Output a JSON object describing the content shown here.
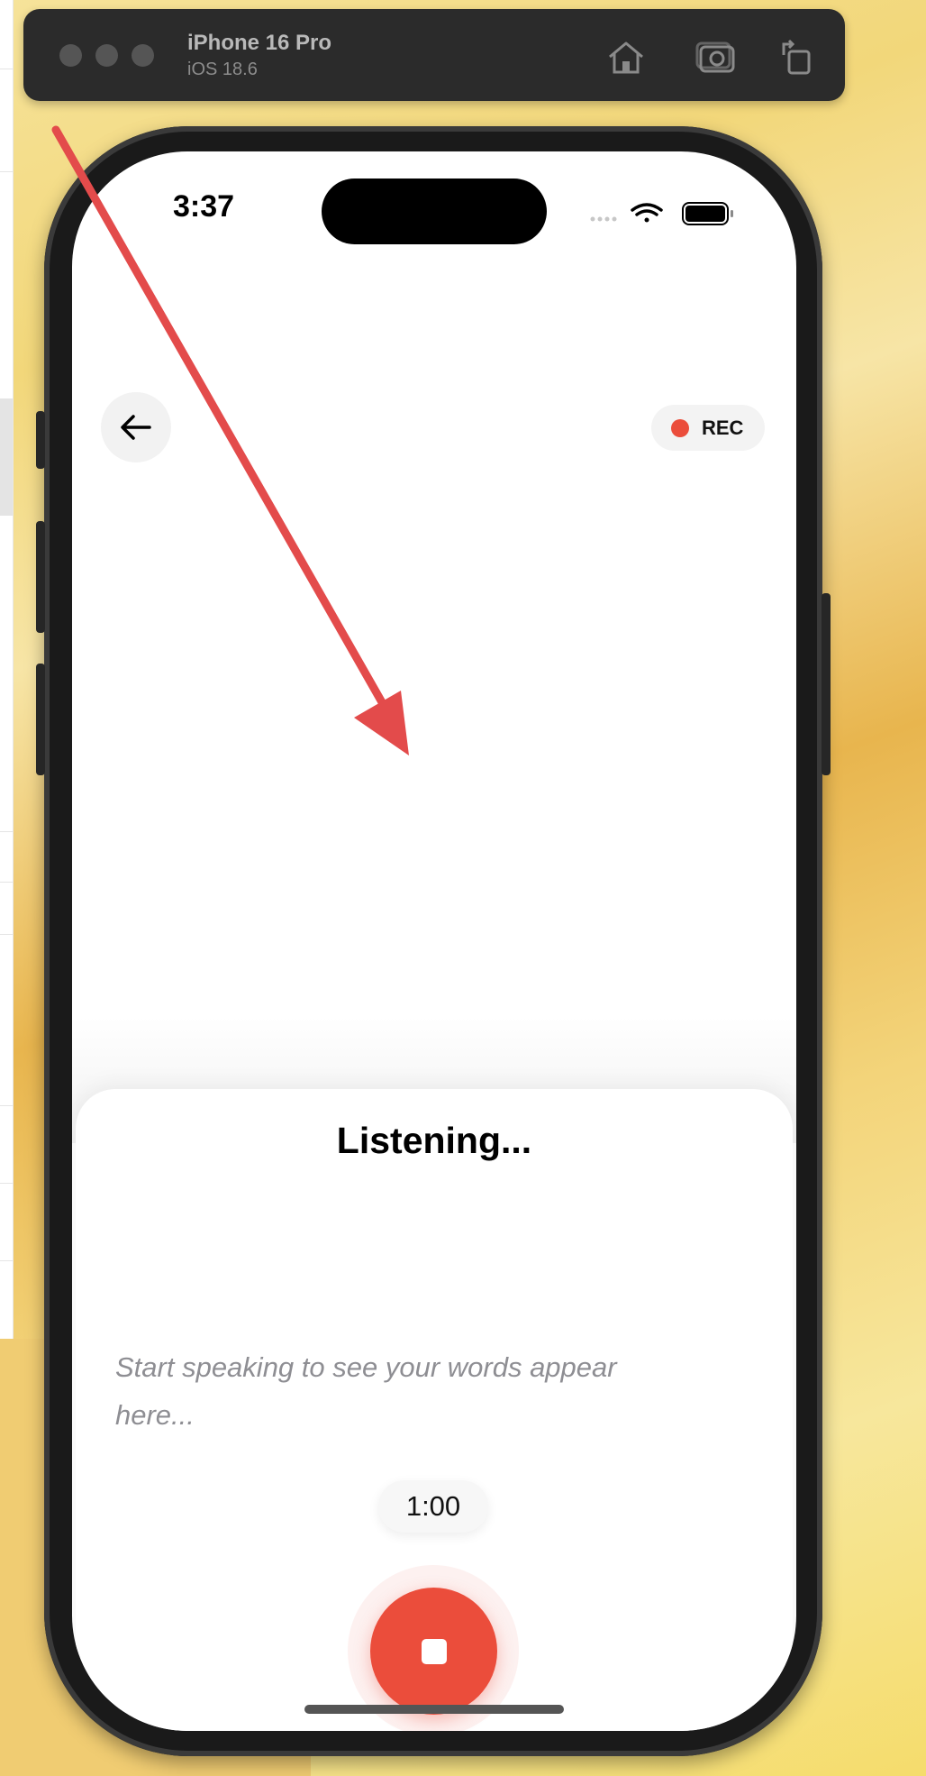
{
  "simulator": {
    "device_name": "iPhone 16 Pro",
    "os_version": "iOS 18.6",
    "toolbar": [
      "home-icon",
      "screenshot-icon",
      "rotate-icon"
    ]
  },
  "status_bar": {
    "time": "3:37",
    "icons": [
      "cellular-icon",
      "wifi-icon",
      "battery-icon"
    ]
  },
  "header": {
    "back_icon": "arrow-left-icon",
    "rec_label": "REC"
  },
  "sheet": {
    "title": "Listening...",
    "transcript_placeholder": "Start speaking to see your words appear here...",
    "timer": "1:00",
    "stop_icon": "stop-icon"
  },
  "colors": {
    "accent_red": "#eb4d3b",
    "annotation_arrow": "#e34b4b"
  }
}
